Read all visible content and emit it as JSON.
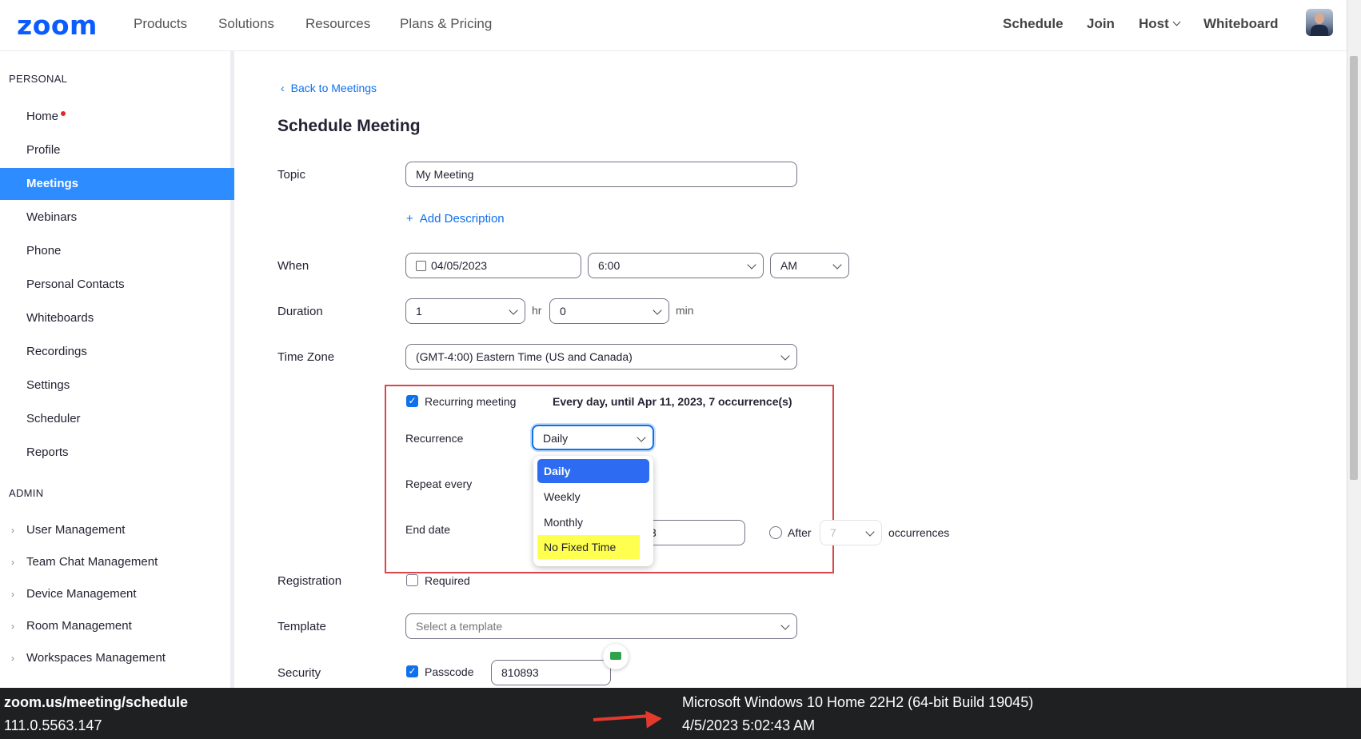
{
  "nav": {
    "logo": "zoom",
    "links": [
      "Products",
      "Solutions",
      "Resources",
      "Plans & Pricing"
    ],
    "right": {
      "schedule": "Schedule",
      "join": "Join",
      "host": "Host",
      "whiteboard": "Whiteboard"
    }
  },
  "sidebar": {
    "personal_label": "PERSONAL",
    "items": [
      "Home",
      "Profile",
      "Meetings",
      "Webinars",
      "Phone",
      "Personal Contacts",
      "Whiteboards",
      "Recordings",
      "Settings",
      "Scheduler",
      "Reports"
    ],
    "admin_label": "ADMIN",
    "admin_items": [
      "User Management",
      "Team Chat Management",
      "Device Management",
      "Room Management",
      "Workspaces Management"
    ]
  },
  "main": {
    "back": "Back to Meetings",
    "title": "Schedule Meeting",
    "topic_label": "Topic",
    "topic_value": "My Meeting",
    "add_description": "Add Description",
    "when_label": "When",
    "date": "04/05/2023",
    "time": "6:00",
    "ampm": "AM",
    "duration_label": "Duration",
    "duration_hr": "1",
    "hr_unit": "hr",
    "duration_min": "0",
    "min_unit": "min",
    "timezone_label": "Time Zone",
    "timezone": "(GMT-4:00) Eastern Time (US and Canada)",
    "recurring_label": "Recurring meeting",
    "recurring_summary": "Every day, until Apr 11, 2023, 7 occurrence(s)",
    "recurrence_label": "Recurrence",
    "recurrence_value": "Daily",
    "recurrence_options": [
      "Daily",
      "Weekly",
      "Monthly",
      "No Fixed Time"
    ],
    "repeat_every_label": "Repeat every",
    "end_date_label": "End date",
    "end_date_partial": "3",
    "after_label": "After",
    "after_value": "7",
    "occurrences_label": "occurrences",
    "registration_label": "Registration",
    "required_label": "Required",
    "template_label": "Template",
    "template_placeholder": "Select a template",
    "security_label": "Security",
    "passcode_label": "Passcode",
    "passcode_value": "810893"
  },
  "bottombar": {
    "url": "zoom.us/meeting/schedule",
    "version": "111.0.5563.147",
    "os": "Microsoft Windows 10 Home 22H2 (64-bit Build 19045)",
    "datetime": "4/5/2023 5:02:43 AM"
  },
  "colors": {
    "brand": "#0b5cff",
    "accent": "#2d8cff",
    "highlight": "#ffff4f",
    "annotation": "#d8474c"
  }
}
